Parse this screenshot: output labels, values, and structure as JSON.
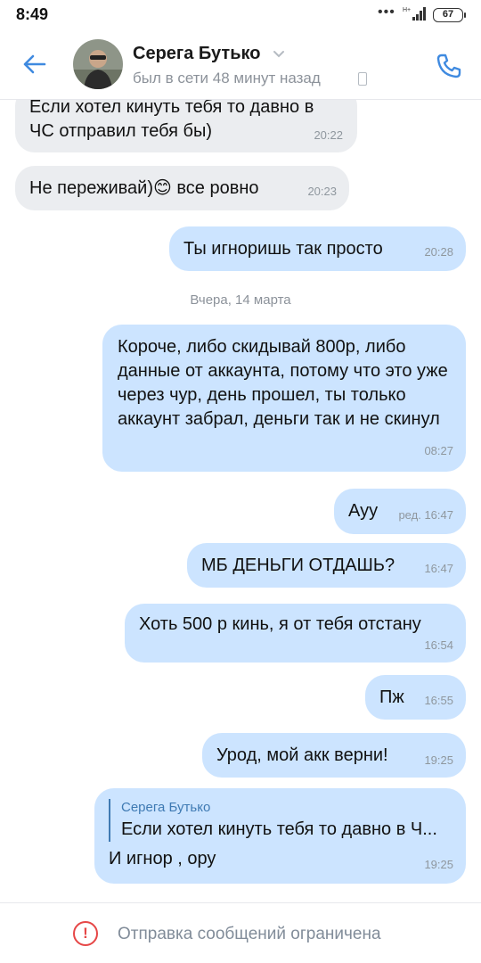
{
  "status_bar": {
    "time": "8:49",
    "signal_label": "H+",
    "battery": "67"
  },
  "header": {
    "contact_name": "Серега Бутько",
    "status": "был в сети 48 минут назад"
  },
  "messages": [
    {
      "direction": "in",
      "text": "Если хотел кинуть тебя то давно в ЧС отправил тебя бы)",
      "time": "20:22"
    },
    {
      "direction": "in",
      "text": "Не переживай)😊 все ровно",
      "time": "20:23"
    },
    {
      "direction": "out",
      "text": "Ты игноришь так просто",
      "time": "20:28"
    },
    {
      "direction": "out",
      "text": "Короче, либо скидывай 800р, либо данные от аккаунта, потому что это уже через чур, день прошел, ты только аккаунт забрал, деньги так и не скинул",
      "time": "08:27"
    },
    {
      "direction": "out",
      "text": "Ауу",
      "time": "16:47",
      "edited": "ред."
    },
    {
      "direction": "out",
      "text": "МБ ДЕНЬГИ ОТДАШЬ?",
      "time": "16:47"
    },
    {
      "direction": "out",
      "text": "Хоть 500 р кинь, я от тебя отстану",
      "time": "16:54"
    },
    {
      "direction": "out",
      "text": "Пж",
      "time": "16:55"
    },
    {
      "direction": "out",
      "text": "Урод, мой акк верни!",
      "time": "19:25"
    },
    {
      "direction": "out",
      "text": "И игнор , ору",
      "time": "19:25",
      "reply": {
        "author": "Серега Бутько",
        "text": "Если хотел кинуть тебя то давно в Ч..."
      }
    }
  ],
  "date_separator": "Вчера, 14 марта",
  "footer": {
    "text": "Отправка сообщений ограничена",
    "icon_symbol": "!"
  },
  "colors": {
    "accent": "#3f8ae0",
    "outgoing_bubble": "#cce4ff",
    "incoming_bubble": "#ebedf0",
    "warning": "#e64646"
  }
}
